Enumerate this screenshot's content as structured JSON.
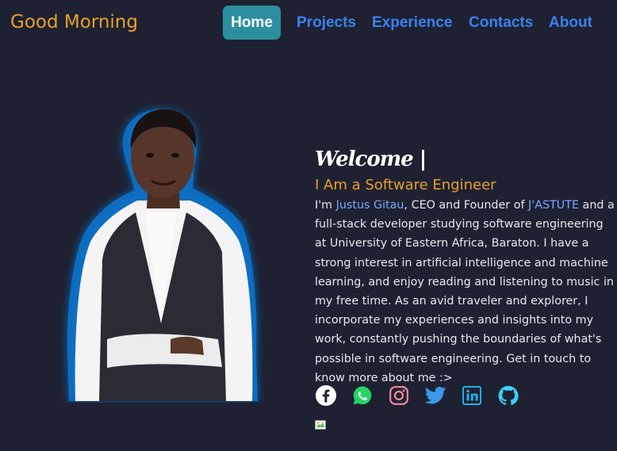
{
  "header": {
    "greeting": "Good Morning",
    "nav": [
      {
        "label": "Home",
        "active": true
      },
      {
        "label": "Projects",
        "active": false
      },
      {
        "label": "Experience",
        "active": false
      },
      {
        "label": "Contacts",
        "active": false
      },
      {
        "label": "About",
        "active": false
      }
    ]
  },
  "hero": {
    "welcome": "Welcome |",
    "role": "I Am a Software Engineer",
    "bio": {
      "p1": "I'm ",
      "name": "Justus Gitau",
      "p2": ", CEO and Founder of ",
      "company": "J'ASTUTE",
      "p3": " and a full-stack developer studying software engineering at University of Eastern Africa, Baraton. I have a strong interest in artificial intelligence and machine learning, and enjoy reading and listening to music in my free time. As an avid traveler and explorer, I incorporate my experiences and insights into my work, constantly pushing the boundaries of what's possible in software engineering. Get in touch to know more about me :>"
    }
  },
  "socials": [
    {
      "icon": "facebook-icon",
      "color": "#ffffff"
    },
    {
      "icon": "whatsapp-icon",
      "color": "#25d366"
    },
    {
      "icon": "instagram-icon",
      "color": "#f28b9e"
    },
    {
      "icon": "twitter-icon",
      "color": "#3a9ae8"
    },
    {
      "icon": "linkedin-icon",
      "color": "#1fb0e8"
    },
    {
      "icon": "github-icon",
      "color": "#3ad0f5"
    }
  ],
  "colors": {
    "background": "#1e2132",
    "accent_orange": "#e8a02a",
    "nav_blue": "#3a82f0",
    "nav_active_bg": "#2c8f9e",
    "highlight": "#7aa7ff"
  }
}
